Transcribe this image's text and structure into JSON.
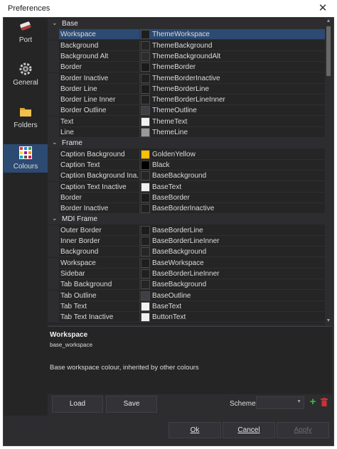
{
  "window": {
    "title": "Preferences"
  },
  "sidebar": {
    "items": [
      {
        "label": "Port",
        "icon": "eraser-icon"
      },
      {
        "label": "General",
        "icon": "gear-icon"
      },
      {
        "label": "Folders",
        "icon": "folder-icon"
      },
      {
        "label": "Colours",
        "icon": "palette-icon",
        "active": true
      }
    ]
  },
  "grid": {
    "categories": [
      {
        "name": "Base",
        "rows": [
          {
            "property": "Workspace",
            "value": "ThemeWorkspace",
            "color": "#1e1e1e",
            "selected": true
          },
          {
            "property": "Background",
            "value": "ThemeBackground",
            "color": "#252526"
          },
          {
            "property": "Background Alt",
            "value": "ThemeBackgroundAlt",
            "color": "#2d2d30"
          },
          {
            "property": "Border",
            "value": "ThemeBorder",
            "color": "#1a1a1a"
          },
          {
            "property": "Border Inactive",
            "value": "ThemeBorderInactive",
            "color": "#202020"
          },
          {
            "property": "Border Line",
            "value": "ThemeBorderLine",
            "color": "#1c1c1c"
          },
          {
            "property": "Border Line Inner",
            "value": "ThemeBorderLineInner",
            "color": "#202020"
          },
          {
            "property": "Border Outline",
            "value": "ThemeOutline",
            "color": "#3f3f46"
          },
          {
            "property": "Text",
            "value": "ThemeText",
            "color": "#f1f1f1"
          },
          {
            "property": "Line",
            "value": "ThemeLine",
            "color": "#9a9a9a"
          }
        ]
      },
      {
        "name": "Frame",
        "rows": [
          {
            "property": "Caption Background",
            "value": "GoldenYellow",
            "color": "#ffc000"
          },
          {
            "property": "Caption Text",
            "value": "Black",
            "color": "#000000"
          },
          {
            "property": "Caption Background Ina...",
            "value": "BaseBackground",
            "color": "#252526"
          },
          {
            "property": "Caption Text Inactive",
            "value": "BaseText",
            "color": "#f1f1f1"
          },
          {
            "property": "Border",
            "value": "BaseBorder",
            "color": "#1a1a1a"
          },
          {
            "property": "Border Inactive",
            "value": "BaseBorderInactive",
            "color": "#202020"
          }
        ]
      },
      {
        "name": "MDI Frame",
        "rows": [
          {
            "property": "Outer Border",
            "value": "BaseBorderLine",
            "color": "#1c1c1c"
          },
          {
            "property": "Inner Border",
            "value": "BaseBorderLineInner",
            "color": "#202020"
          },
          {
            "property": "Background",
            "value": "BaseBackground",
            "color": "#252526"
          },
          {
            "property": "Workspace",
            "value": "BaseWorkspace",
            "color": "#1e1e1e"
          },
          {
            "property": "Sidebar",
            "value": "BaseBorderLineInner",
            "color": "#202020"
          },
          {
            "property": "Tab Background",
            "value": "BaseBackground",
            "color": "#252526"
          },
          {
            "property": "Tab Outline",
            "value": "BaseOutline",
            "color": "#3f3f46"
          },
          {
            "property": "Tab Text",
            "value": "BaseText",
            "color": "#f1f1f1"
          },
          {
            "property": "Tab Text Inactive",
            "value": "ButtonText",
            "color": "#f1f1f1"
          }
        ]
      }
    ]
  },
  "description": {
    "title": "Workspace",
    "key": "base_workspace",
    "text": "Base workspace colour, inherited by other colours"
  },
  "toolbar": {
    "load_label": "Load",
    "save_label": "Save",
    "scheme_label": "Scheme",
    "scheme_value": ""
  },
  "footer": {
    "ok_label": "Ok",
    "cancel_label": "Cancel",
    "apply_label": "Apply"
  },
  "colors": {
    "accent": "#2c4a72",
    "panel": "#252526",
    "chrome": "#2d2d30",
    "add": "#3fb93f",
    "delete": "#d03030"
  }
}
